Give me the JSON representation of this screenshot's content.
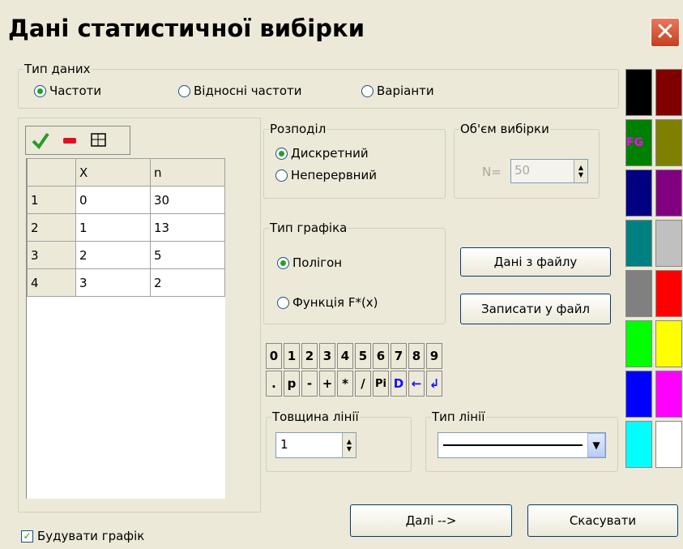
{
  "window": {
    "title": "Дані статистичної вибірки",
    "close_icon": "close-icon"
  },
  "data_type": {
    "legend": "Тип даних",
    "options": [
      "Частоти",
      "Відносні частоти",
      "Варіанти"
    ],
    "selected": "Частоти"
  },
  "toolbar": {
    "icons": [
      "checkmark-icon",
      "minus-icon",
      "table-icon"
    ]
  },
  "table": {
    "headers": [
      "",
      "X",
      "n"
    ],
    "rows": [
      [
        "1",
        "0",
        "30"
      ],
      [
        "2",
        "1",
        "13"
      ],
      [
        "3",
        "2",
        "5"
      ],
      [
        "4",
        "3",
        "2"
      ]
    ]
  },
  "distribution": {
    "legend": "Розподіл",
    "options": [
      "Дискретний",
      "Неперервний"
    ],
    "selected": "Дискретний"
  },
  "sample_size": {
    "legend": "Об'єм вибірки",
    "label": "N=",
    "value": "50"
  },
  "graph_type": {
    "legend": "Тип графіка",
    "options": [
      "Полігон",
      "Функція F*(x)"
    ],
    "selected": "Полігон"
  },
  "buttons": {
    "load_file": "Дані з файлу",
    "save_file": "Записати у файл",
    "next": "Далі -->",
    "cancel": "Скасувати"
  },
  "keypad": {
    "row1": [
      "0",
      "1",
      "2",
      "3",
      "4",
      "5",
      "6",
      "7",
      "8",
      "9"
    ],
    "row2": [
      ".",
      "p",
      "-",
      "+",
      "*",
      "/",
      "Pi",
      "D",
      "←",
      "↲"
    ]
  },
  "line_width": {
    "legend": "Товщина лінії",
    "value": "1"
  },
  "line_type": {
    "legend": "Тип лінії"
  },
  "build_graph": {
    "label": "Будувати графік",
    "checked": true
  },
  "palette": {
    "colors": [
      "#000000",
      "#800000",
      "#008000",
      "#808000",
      "#000080",
      "#800080",
      "#008080",
      "#c0c0c0",
      "#808080",
      "#ff0000",
      "#00ff00",
      "#ffff00",
      "#0000ff",
      "#ff00ff",
      "#00ffff",
      "#ffffff"
    ],
    "fg_label": "FG"
  }
}
